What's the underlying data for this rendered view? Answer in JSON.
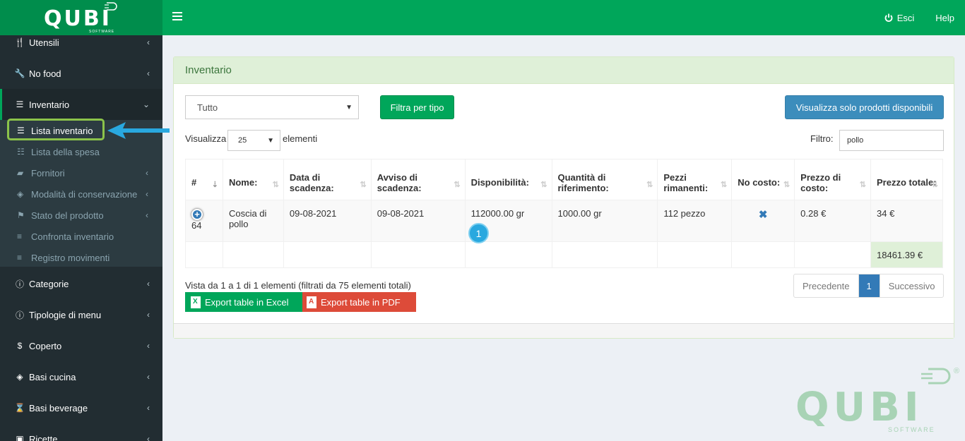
{
  "brand": {
    "name": "QUBI",
    "sub": "SOFTWARE"
  },
  "topbar": {
    "logout_label": "Esci",
    "help_label": "Help"
  },
  "sidebar": {
    "items": [
      {
        "label": "Utensili",
        "icon": "cutlery-icon"
      },
      {
        "label": "No food",
        "icon": "wrench-icon"
      },
      {
        "label": "Inventario",
        "icon": "list-icon"
      },
      {
        "label": "Categorie",
        "icon": "info-icon"
      },
      {
        "label": "Tipologie di menu",
        "icon": "info-icon"
      },
      {
        "label": "Coperto",
        "icon": "dollar-icon"
      },
      {
        "label": "Basi cucina",
        "icon": "cube-icon"
      },
      {
        "label": "Basi beverage",
        "icon": "hourglass-icon"
      },
      {
        "label": "Ricette",
        "icon": "book-icon"
      }
    ],
    "sub_items": [
      {
        "label": "Lista inventario",
        "icon": "list-icon"
      },
      {
        "label": "Lista della spesa",
        "icon": "list-ol-icon"
      },
      {
        "label": "Fornitori",
        "icon": "truck-icon"
      },
      {
        "label": "Modalità di conservazione",
        "icon": "cube-icon"
      },
      {
        "label": "Stato del prodotto",
        "icon": "flag-icon"
      },
      {
        "label": "Confronta inventario",
        "icon": "bars-icon"
      },
      {
        "label": "Registro movimenti",
        "icon": "bars-icon"
      }
    ]
  },
  "panel": {
    "title": "Inventario",
    "type_select": "Tutto",
    "filter_type_button": "Filtra per tipo",
    "available_button": "Visualizza solo prodotti disponibili",
    "show_label": "Visualizza",
    "page_size": "25",
    "elements_label": "elementi",
    "filter_label": "Filtro:",
    "filter_value": "pollo"
  },
  "table": {
    "headers": [
      "#",
      "Nome:",
      "Data di scadenza:",
      "Avviso di scadenza:",
      "Disponibilità:",
      "Quantità di riferimento:",
      "Pezzi rimanenti:",
      "No costo:",
      "Prezzo di costo:",
      "Prezzo totale:"
    ],
    "rows": [
      {
        "id": "64",
        "name": "Coscia di pollo",
        "expiry": "09-08-2021",
        "expiry_warning": "09-08-2021",
        "availability": "112000.00 gr",
        "reference_qty": "1000.00 gr",
        "pieces": "112 pezzo",
        "no_cost": "✖",
        "cost_price": "0.28 €",
        "total_price": "34 €"
      }
    ],
    "grand_total": "18461.39 €"
  },
  "footer": {
    "info": "Vista da 1 a 1 di 1 elementi (filtrati da 75 elementi totali)",
    "excel_button": "Export table in Excel",
    "pdf_button": "Export table in PDF",
    "pager": {
      "prev": "Precedente",
      "current": "1",
      "next": "Successivo"
    }
  },
  "annotation": {
    "step": "1"
  },
  "watermark": {
    "name": "QUBI",
    "sub": "SOFTWARE",
    "reg": "®"
  },
  "colors": {
    "green": "#00a65a",
    "sidebar": "#222d32",
    "blue": "#3c8dbc",
    "red": "#dd4b39"
  }
}
